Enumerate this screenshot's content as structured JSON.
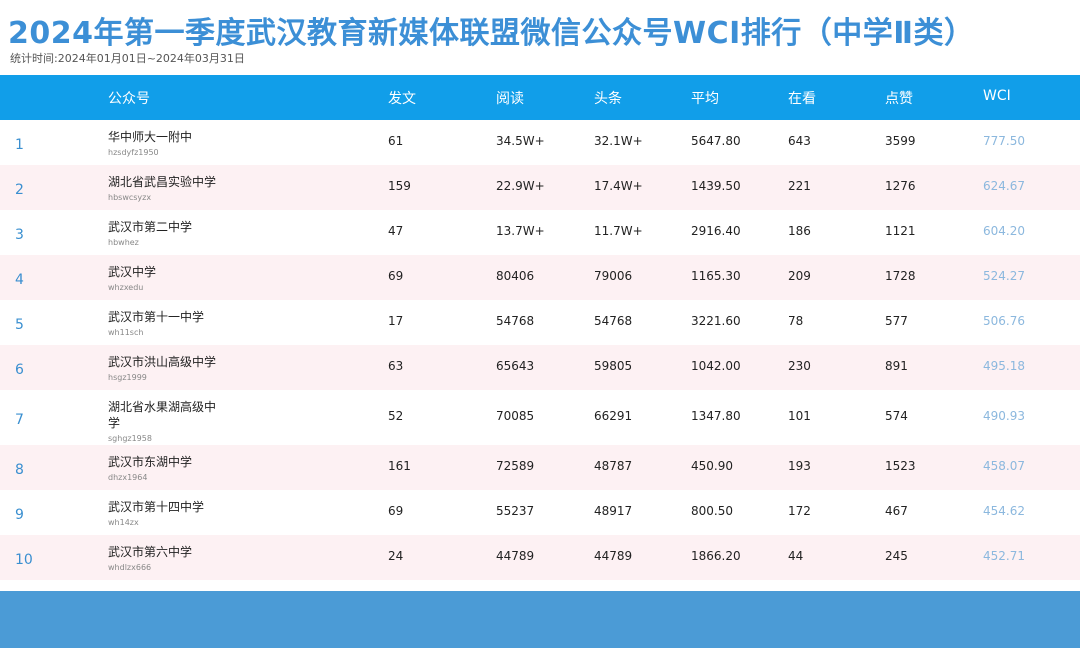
{
  "title": "2024年第一季度武汉教育新媒体联盟微信公众号WCI排行（中学Ⅱ类）",
  "subtitle": "统计时间:2024年01月01日~2024年03月31日",
  "headers": {
    "account": "公众号",
    "posts": "发文",
    "reads": "阅读",
    "headline": "头条",
    "average": "平均",
    "watching": "在看",
    "likes": "点赞",
    "wci": "WCI"
  },
  "rows": [
    {
      "rank": "1",
      "name": "华中师大一附中",
      "account": "hzsdyfz1950",
      "posts": "61",
      "reads": "34.5W+",
      "headline": "32.1W+",
      "average": "5647.80",
      "watching": "643",
      "likes": "3599",
      "wci": "777.50"
    },
    {
      "rank": "2",
      "name": "湖北省武昌实验中学",
      "account": "hbswcsyzx",
      "posts": "159",
      "reads": "22.9W+",
      "headline": "17.4W+",
      "average": "1439.50",
      "watching": "221",
      "likes": "1276",
      "wci": "624.67"
    },
    {
      "rank": "3",
      "name": "武汉市第二中学",
      "account": "hbwhez",
      "posts": "47",
      "reads": "13.7W+",
      "headline": "11.7W+",
      "average": "2916.40",
      "watching": "186",
      "likes": "1121",
      "wci": "604.20"
    },
    {
      "rank": "4",
      "name": "武汉中学",
      "account": "whzxedu",
      "posts": "69",
      "reads": "80406",
      "headline": "79006",
      "average": "1165.30",
      "watching": "209",
      "likes": "1728",
      "wci": "524.27"
    },
    {
      "rank": "5",
      "name": "武汉市第十一中学",
      "account": "wh11sch",
      "posts": "17",
      "reads": "54768",
      "headline": "54768",
      "average": "3221.60",
      "watching": "78",
      "likes": "577",
      "wci": "506.76"
    },
    {
      "rank": "6",
      "name": "武汉市洪山高级中学",
      "account": "hsgz1999",
      "posts": "63",
      "reads": "65643",
      "headline": "59805",
      "average": "1042.00",
      "watching": "230",
      "likes": "891",
      "wci": "495.18"
    },
    {
      "rank": "7",
      "name": "湖北省水果湖高级中学",
      "account": "sghgz1958",
      "posts": "52",
      "reads": "70085",
      "headline": "66291",
      "average": "1347.80",
      "watching": "101",
      "likes": "574",
      "wci": "490.93"
    },
    {
      "rank": "8",
      "name": "武汉市东湖中学",
      "account": "dhzx1964",
      "posts": "161",
      "reads": "72589",
      "headline": "48787",
      "average": "450.90",
      "watching": "193",
      "likes": "1523",
      "wci": "458.07"
    },
    {
      "rank": "9",
      "name": "武汉市第十四中学",
      "account": "wh14zx",
      "posts": "69",
      "reads": "55237",
      "headline": "48917",
      "average": "800.50",
      "watching": "172",
      "likes": "467",
      "wci": "454.62"
    },
    {
      "rank": "10",
      "name": "武汉市第六中学",
      "account": "whdlzx666",
      "posts": "24",
      "reads": "44789",
      "headline": "44789",
      "average": "1866.20",
      "watching": "44",
      "likes": "245",
      "wci": "452.71"
    }
  ],
  "colors": {
    "title": "#3c8fd6",
    "header_bg": "#119ee9",
    "row_alt_bg": "#fdf1f3",
    "rank": "#3a8fd0",
    "wci": "#8cb8de",
    "footer_band": "#4b9bd6"
  }
}
